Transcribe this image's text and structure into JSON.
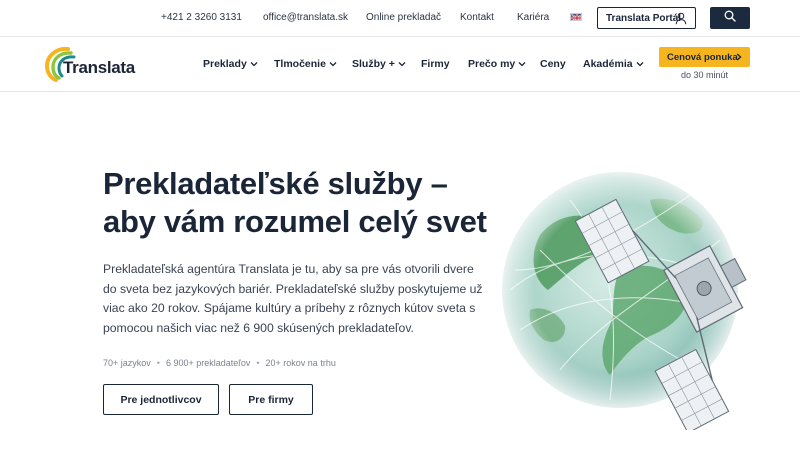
{
  "topbar": {
    "phone": "+421 2 3260 3131",
    "email": "office@translata.sk",
    "online": "Online prekladač",
    "contact": "Kontakt",
    "career": "Kariéra",
    "portal": "Translata Portál"
  },
  "brand": {
    "name": "Translata"
  },
  "nav": {
    "items": [
      "Preklady",
      "Tlmočenie",
      "Služby +",
      "Firmy",
      "Prečo my",
      "Ceny",
      "Akadémia"
    ],
    "cta": "Cenová ponuka",
    "cta_sub": "do 30 minút"
  },
  "hero": {
    "title_line1": "Prekladateľské služby –",
    "title_line2": "aby vám rozumel celý svet",
    "paragraph": "Prekladateľská agentúra Translata je tu, aby sa pre vás otvorili dvere do sveta bez jazykových bariér. Prekladateľské služby poskytujeme už viac ako 20 rokov. Spájame kultúry a príbehy z rôznych kútov sveta s pomocou našich viac než 6 900 skúsených prekladateľov.",
    "stats": [
      "70+ jazykov",
      "6 900+ prekladateľov",
      "20+ rokov na trhu"
    ],
    "stat_separator": "•",
    "btn_individuals": "Pre jednotlivcov",
    "btn_companies": "Pre firmy"
  },
  "colors": {
    "navy": "#1c2a3f",
    "accent": "#f6b51e",
    "logo_green": "#8cc63f",
    "logo_teal": "#1f8a8a"
  },
  "icons": [
    "user-icon",
    "search-icon",
    "chevron-down-icon",
    "chevron-right-icon",
    "uk-flag-icon"
  ]
}
